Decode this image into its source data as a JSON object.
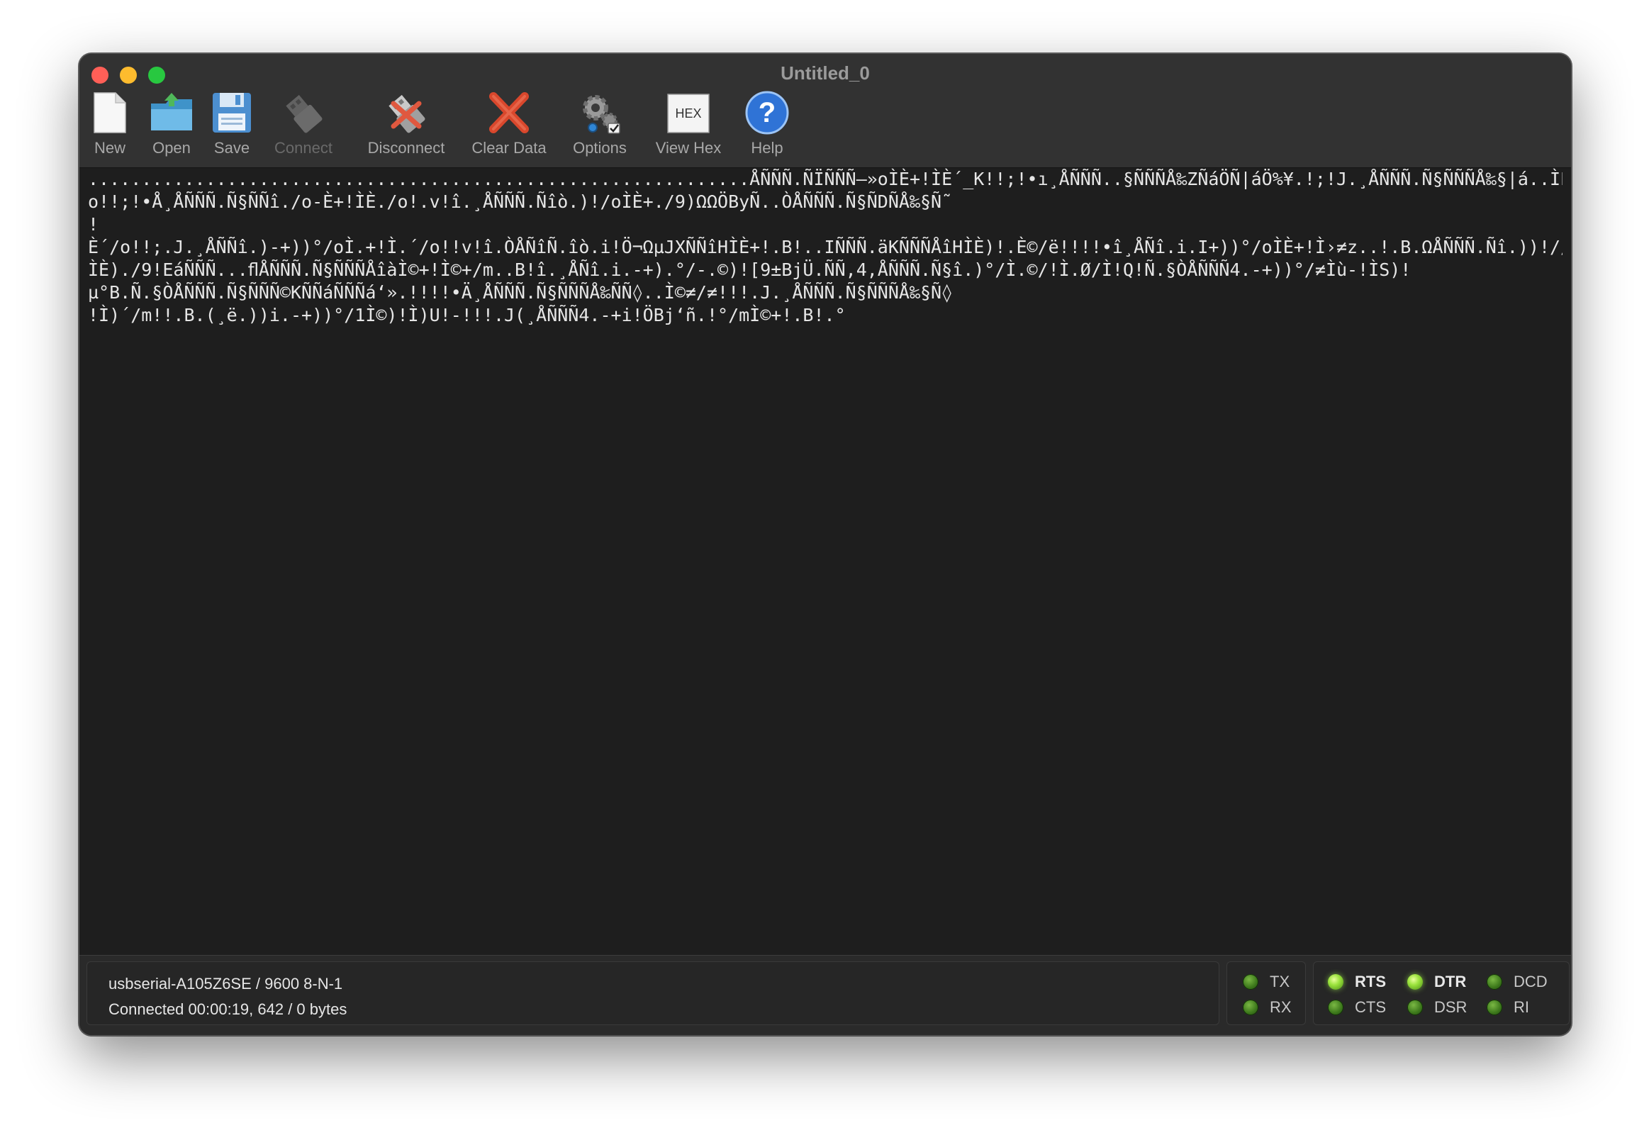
{
  "window": {
    "title": "Untitled_0"
  },
  "toolbar": {
    "items": [
      {
        "label": "New",
        "icon": "new-document-icon",
        "enabled": true
      },
      {
        "label": "Open",
        "icon": "open-folder-icon",
        "enabled": true
      },
      {
        "label": "Save",
        "icon": "save-floppy-icon",
        "enabled": true
      },
      {
        "label": "Connect",
        "icon": "usb-plug-icon",
        "enabled": false
      },
      {
        "label": "Disconnect",
        "icon": "disconnect-plug-icon",
        "enabled": true
      },
      {
        "label": "Clear Data",
        "icon": "clear-x-icon",
        "enabled": true
      },
      {
        "label": "Options",
        "icon": "gears-icon",
        "enabled": true
      },
      {
        "label": "View Hex",
        "icon": "hex-icon",
        "enabled": true
      },
      {
        "label": "Help",
        "icon": "help-question-icon",
        "enabled": true
      }
    ],
    "hex_icon_text": "HEX"
  },
  "terminal": {
    "lines": [
      "..............................................................ÅÑÑÑ.ÑÏÑÑÑ–»oÌÈ+!ÌÈ´_K!!;!•ı¸ÅÑÑÑ..§ÑÑÑÅ‰ZÑáÖÑ|áÖ%¥.!;!J.¸ÅÑÑÑ.Ñ§ÑÑÑÅ‰§|á..ÌÈ´/",
      "o!!;!•Å¸ÅÑÑÑ.Ñ§ÑÑî./o-È+!ÌÈ./o!.v!î.¸ÅÑÑÑ.Ñîò.)!/oÌÈ+./9)ΩΩÖByÑ..ÒÅÑÑÑ.Ñ§ÑDÑÅ‰§Ñ˜",
      "!",
      "È´/o!!;.J.¸ÅÑÑî.)-+))°/oÌ.+!Ì.´/o!!v!î.ÒÅÑîÑ.îò.i!Ö¬ΩµJXÑÑîHÌÈ+!.B!..IÑÑÑ.äKÑÑÑÅîHÌÈ)!.È©/ë!!!!•î¸ÅÑî.i.I+))°/oÌÈ+!Ì›≠z..!.B.ΩÅÑÑÑ.Ñî.))!//",
      "ÌÈ)./9!EáÑÑÑ...ﬂÅÑÑÑ.Ñ§ÑÑÑÅîàÌ©+!Ì©+/m..B!î.¸ÅÑî.i.-+).°/-.©)![9±BjÜ.ÑÑ,4,ÅÑÑÑ.Ñ§î.)°/Ì.©/!Ì.Ø/Ì!Q!Ñ.§ÒÅÑÑÑ4.-+))°/≠Ìù-!ÌS)!",
      "µ°B.Ñ.§ÒÅÑÑÑ.Ñ§ÑÑÑ©KÑÑáÑÑÑá‘».!!!!•Ä¸ÅÑÑÑ.Ñ§ÑÑÑÅ‰ÑÑ◊..Ì©≠/≠!!!.J.¸ÅÑÑÑ.Ñ§ÑÑÑÅ‰§Ñ◊",
      "!Ì)´/m!!.B.(¸ë.))i.-+))°/1Ì©)!Ì)U!-!!!.J(¸ÅÑÑÑ4.-+i!ÖBj‘ñ.!°/mÌ©+!.B!.°"
    ]
  },
  "status": {
    "port_info": "usbserial-A105Z6SE / 9600 8-N-1",
    "connection_info": "Connected 00:00:19, 642 / 0 bytes",
    "lights": [
      {
        "label": "TX",
        "on": false,
        "bold": false
      },
      {
        "label": "RX",
        "on": false,
        "bold": false
      },
      {
        "label": "RTS",
        "on": true,
        "bold": true
      },
      {
        "label": "CTS",
        "on": false,
        "bold": false
      },
      {
        "label": "DTR",
        "on": true,
        "bold": true
      },
      {
        "label": "DSR",
        "on": false,
        "bold": false
      },
      {
        "label": "DCD",
        "on": false,
        "bold": false
      },
      {
        "label": "RI",
        "on": false,
        "bold": false
      }
    ]
  },
  "colors": {
    "led_on": "#9be33d",
    "led_off": "#3e7a1c",
    "close": "#ff5f57",
    "minimize": "#febc2e",
    "maximize": "#28c840"
  }
}
